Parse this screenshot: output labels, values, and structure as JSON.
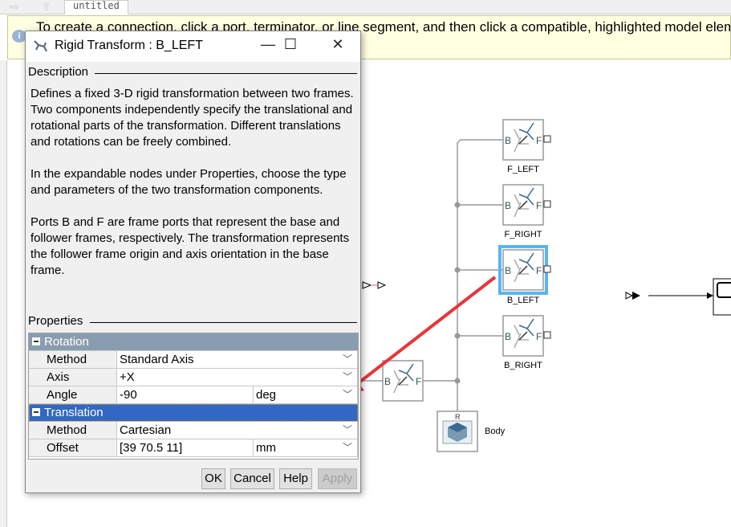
{
  "toolbar": {
    "tab_label": "untitled",
    "back_icon": "arrow-right-icon",
    "up_icon": "arrow-up-icon"
  },
  "banner": {
    "text": "To create a connection, click a port, terminator, or line segment, and then click a compatible, highlighted model element.",
    "icon": "info-icon"
  },
  "dialog": {
    "title": "Rigid Transform : B_LEFT",
    "description_label": "Description",
    "description": [
      "Defines a fixed 3-D rigid transformation between two frames. Two components independently specify the translational and rotational parts of the transformation. Different translations and rotations can be freely combined.",
      "In the expandable nodes under Properties, choose the type and parameters of the two transformation components.",
      "Ports B and F are frame ports that represent the base and follower frames, respectively. The transformation represents the follower frame origin and axis orientation in the base frame."
    ],
    "properties_label": "Properties",
    "rotation": {
      "label": "Rotation",
      "method_label": "Method",
      "method": "Standard Axis",
      "axis_label": "Axis",
      "axis": "+X",
      "angle_label": "Angle",
      "angle": "-90",
      "angle_unit": "deg"
    },
    "translation": {
      "label": "Translation",
      "method_label": "Method",
      "method": "Cartesian",
      "offset_label": "Offset",
      "offset": "[39 70.5 11]",
      "offset_unit": "mm"
    },
    "buttons": {
      "ok": "OK",
      "cancel": "Cancel",
      "help": "Help",
      "apply": "Apply"
    }
  },
  "diagram": {
    "blocks": [
      "F_LEFT",
      "F_RIGHT",
      "B_LEFT",
      "B_RIGHT"
    ],
    "port_b": "B",
    "port_f": "F",
    "body_label": "Body",
    "body_port": "R",
    "selected_block": "B_LEFT",
    "selection_color": "#5ab4f0",
    "annotation_color": "#e8353a"
  }
}
